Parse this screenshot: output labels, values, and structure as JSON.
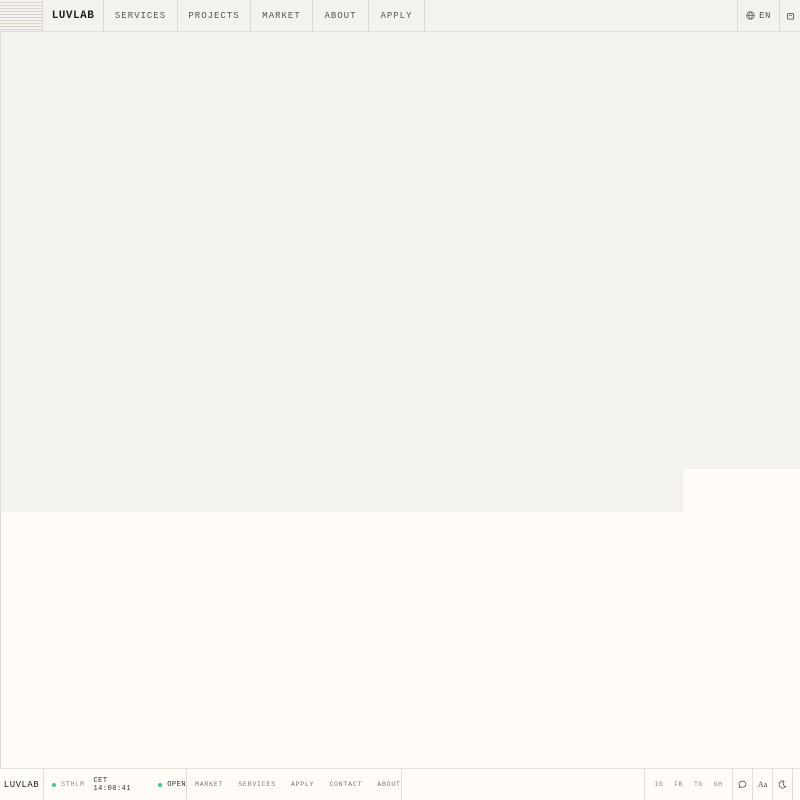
{
  "header": {
    "brand": "LUVLAB",
    "nav": [
      "SERVICES",
      "PROJECTS",
      "MARKET",
      "ABOUT",
      "APPLY"
    ],
    "language": "EN"
  },
  "footer": {
    "brand": "LUVLAB",
    "location": "STHLM",
    "time": "CET 14:00:41",
    "status": "OPEN",
    "links": [
      "MARKET",
      "SERVICES",
      "APPLY",
      "CONTACT",
      "ABOUT"
    ],
    "social": [
      "IG",
      "FB",
      "TG",
      "GH"
    ],
    "font_toggle": "Aa"
  },
  "icons": {
    "menu": "menu-lines-icon",
    "language": "globe-icon",
    "cart": "bag-icon",
    "chat": "chat-icon",
    "theme": "moon-icon"
  },
  "colors": {
    "status_dot": "#3ec98a",
    "hero_bg": "#f4f2ee",
    "page_bg": "#fffcf7"
  }
}
